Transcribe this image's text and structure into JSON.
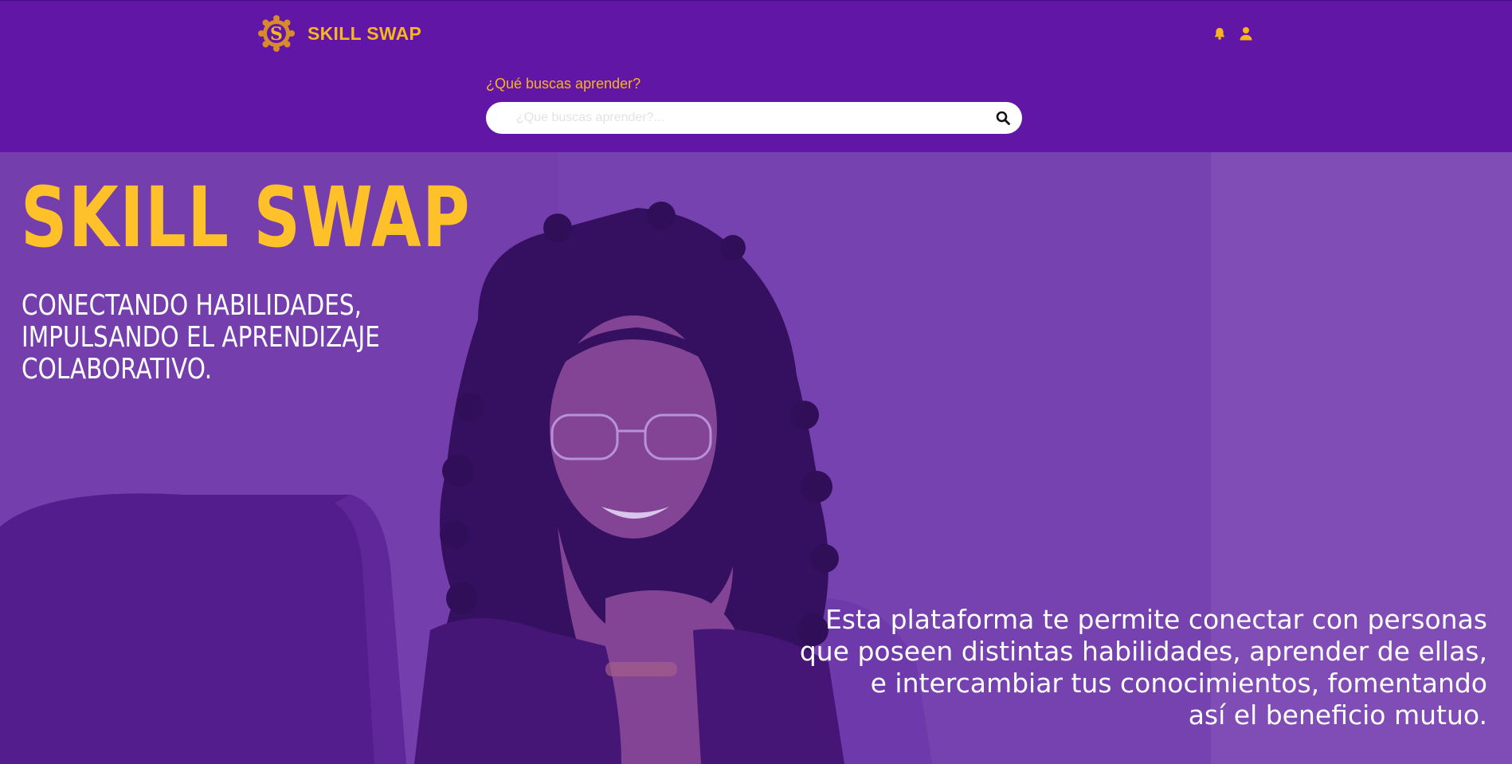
{
  "header": {
    "brand_name": "SKILL SWAP",
    "logo_icon": "gear-s-logo",
    "icons": [
      "bell-icon",
      "user-icon"
    ],
    "search_label": "¿Qué buscas aprender?",
    "search_placeholder": "¿Que buscas aprender?...",
    "search_icon": "search-icon"
  },
  "hero": {
    "title": "SKILL SWAP",
    "tagline_lines": [
      "CONECTANDO HABILIDADES,",
      "IMPULSANDO EL APRENDIZAJE",
      "COLABORATIVO."
    ],
    "description_lines": [
      "Esta plataforma te permite conectar con personas",
      "que poseen distintas habilidades, aprender de ellas,",
      "e intercambiar tus conocimientos, fomentando",
      "así el beneficio mutuo."
    ]
  },
  "colors": {
    "header_bg": "#6216a6",
    "accent": "#f7b51e",
    "hero_overlay": "#7a49b0",
    "text_light": "#ffffff"
  }
}
